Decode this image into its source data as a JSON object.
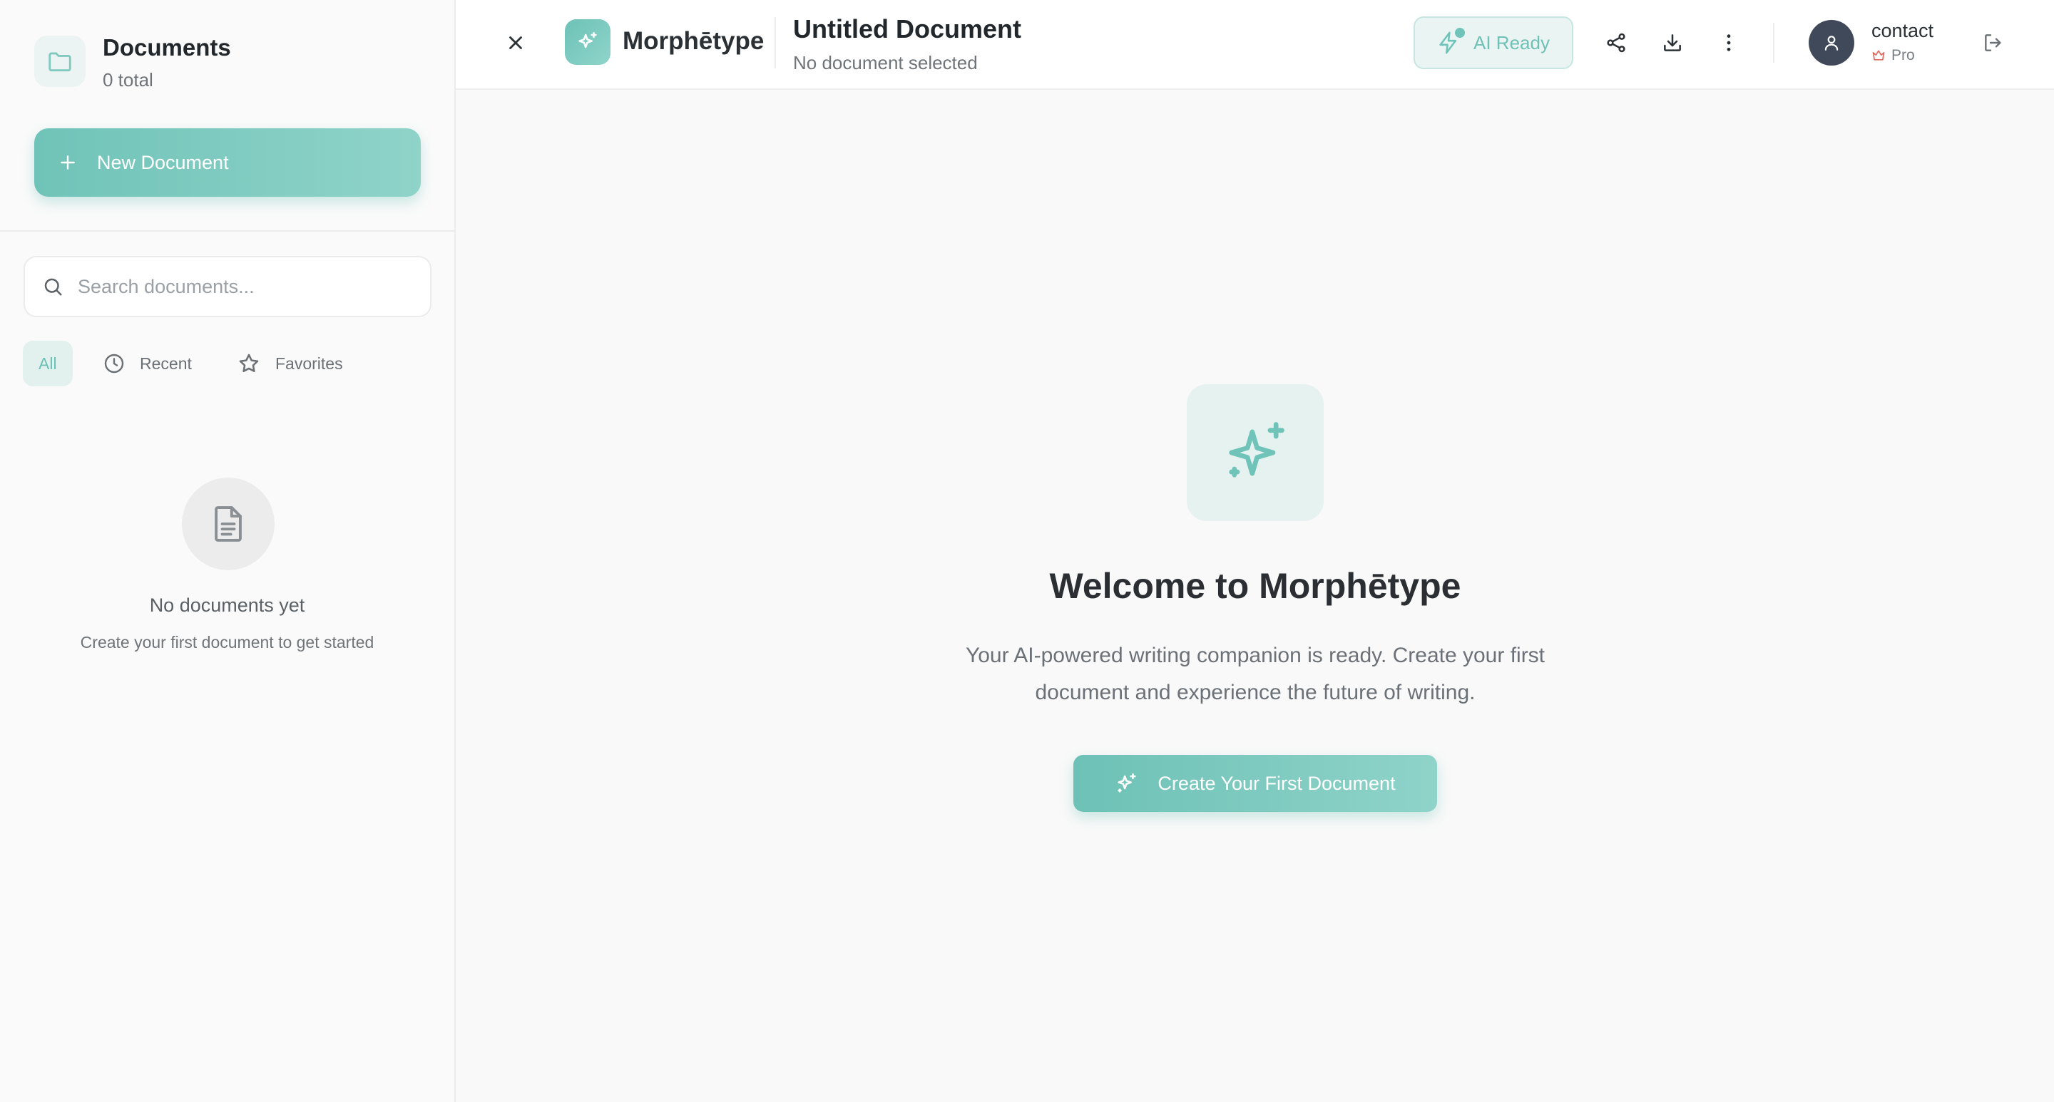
{
  "sidebar": {
    "title": "Documents",
    "count": "0 total",
    "new_button": "New Document",
    "search": {
      "placeholder": "Search documents..."
    },
    "filters": {
      "all": "All",
      "recent": "Recent",
      "favorites": "Favorites"
    },
    "empty": {
      "title": "No documents yet",
      "subtitle": "Create your first document to get started"
    }
  },
  "header": {
    "app_name": "Morphētype",
    "doc_title": "Untitled Document",
    "doc_subtitle": "No document selected",
    "ai_status": "AI Ready",
    "user": {
      "name": "contact",
      "plan": "Pro"
    }
  },
  "main": {
    "title": "Welcome to Morphētype",
    "subtitle_line1": "Your AI-powered writing companion is ready. Create your first",
    "subtitle_line2": "document and experience the future of writing.",
    "cta": "Create Your First Document"
  },
  "colors": {
    "accent": "#70c3b8",
    "accent_light": "#e6f2f0",
    "avatar": "#40495a",
    "crown": "#e0675a"
  },
  "icons": [
    "folder-icon",
    "plus-icon",
    "search-icon",
    "clock-icon",
    "star-icon",
    "file-text-icon",
    "close-icon",
    "sparkles-icon",
    "bolt-icon",
    "share-icon",
    "download-icon",
    "more-vertical-icon",
    "user-icon",
    "crown-icon",
    "logout-icon"
  ]
}
